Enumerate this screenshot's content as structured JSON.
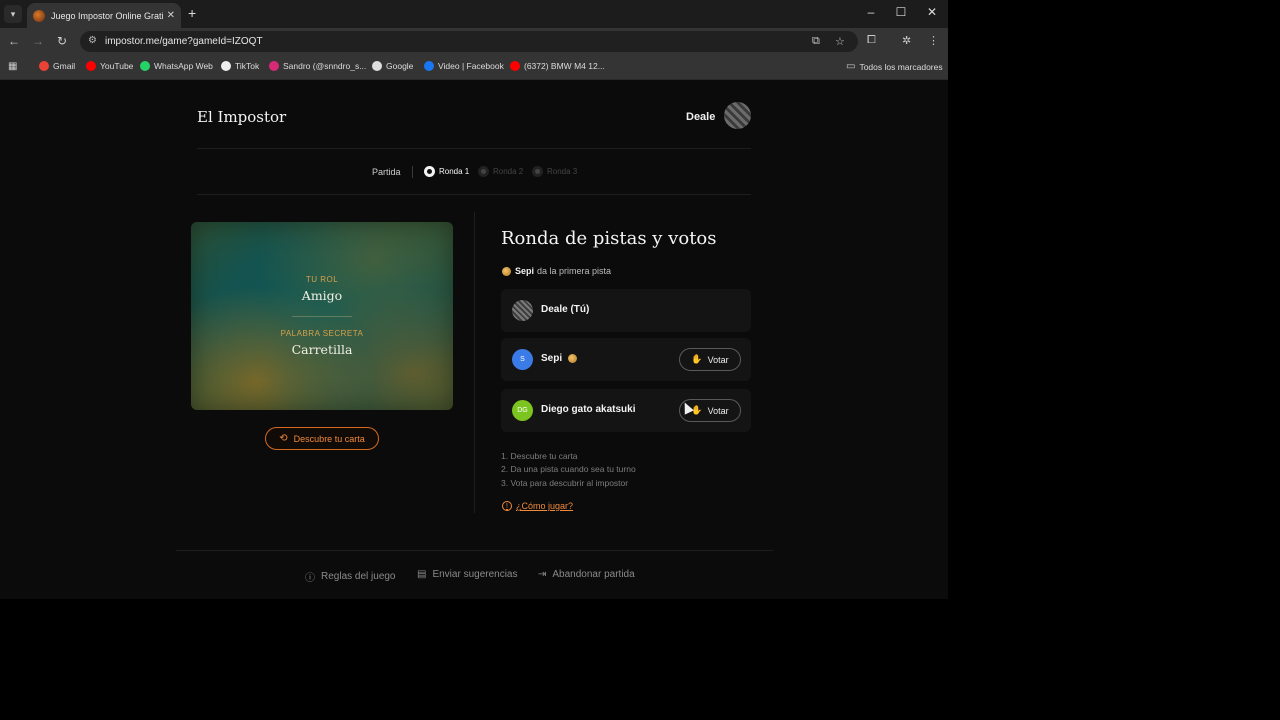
{
  "browser": {
    "tab_title": "Juego Impostor Online Gratis -",
    "tab_close": "✕",
    "new_tab": "+",
    "url": "impostor.me/game?gameId=IZOQT",
    "window_controls": {
      "minimize": "–",
      "maximize": "☐",
      "close": "✕"
    },
    "bookmarks": [
      {
        "label": "Gmail",
        "color": "#ea4335"
      },
      {
        "label": "YouTube",
        "color": "#ff0000"
      },
      {
        "label": "WhatsApp Web",
        "color": "#25d366"
      },
      {
        "label": "TikTok",
        "color": "#eeeeee"
      },
      {
        "label": "Sandro (@snndro_s...",
        "color": "#d62976"
      },
      {
        "label": "Google",
        "color": "#dddddd"
      },
      {
        "label": "Video | Facebook",
        "color": "#1877f2"
      },
      {
        "label": "(6372) BMW M4 12...",
        "color": "#ff0000"
      }
    ],
    "all_bookmarks": "Todos los marcadores"
  },
  "header": {
    "logo": "El Impostor",
    "user_name": "Deale"
  },
  "steps": {
    "label": "Partida",
    "items": [
      {
        "label": "Ronda 1",
        "active": true
      },
      {
        "label": "Ronda 2",
        "active": false
      },
      {
        "label": "Ronda 3",
        "active": false
      }
    ]
  },
  "card": {
    "role_label": "TU ROL",
    "role_value": "Amigo",
    "word_label": "PALABRA SECRETA",
    "word_value": "Carretilla",
    "reveal_button": "Descubre tu carta"
  },
  "round": {
    "title": "Ronda de pistas y votos",
    "first_clue_player": "Sepi",
    "first_clue_text": "da la primera pista",
    "players": [
      {
        "name": "Deale (Tú)",
        "initials": "",
        "avatar_color": "#555555",
        "voteable": false
      },
      {
        "name": "Sepi",
        "initials": "S",
        "avatar_color": "#3b7be8",
        "voteable": true,
        "turn": true
      },
      {
        "name": "Diego gato akatsuki",
        "initials": "DG",
        "avatar_color": "#7cc520",
        "voteable": true
      }
    ],
    "vote_label": "Votar",
    "instructions": [
      "1. Descubre tu carta",
      "2. Da una pista cuando sea tu turno",
      "3. Vota para descubrir al impostor"
    ],
    "how_to_play": "¿Cómo jugar?"
  },
  "footer": {
    "rules": "Reglas del juego",
    "suggestions": "Enviar sugerencias",
    "leave": "Abandonar partida"
  }
}
